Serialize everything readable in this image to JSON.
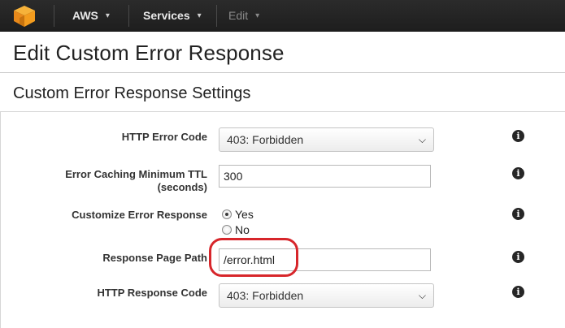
{
  "nav": {
    "brand": "AWS",
    "services": "Services",
    "edit": "Edit",
    "chevron": "▾",
    "logo_color": "#f39c1e"
  },
  "page": {
    "title": "Edit Custom Error Response",
    "section_title": "Custom Error Response Settings"
  },
  "form": {
    "http_error_code": {
      "label": "HTTP Error Code",
      "value": "403: Forbidden"
    },
    "caching_ttl": {
      "label": "Error Caching Minimum TTL",
      "label_line2": "(seconds)",
      "value": "300"
    },
    "customize": {
      "label": "Customize Error Response",
      "option_yes": "Yes",
      "option_no": "No",
      "selected": "Yes"
    },
    "response_page_path": {
      "label": "Response Page Path",
      "value": "/error.html"
    },
    "http_response_code": {
      "label": "HTTP Response Code",
      "value": "403: Forbidden"
    },
    "info_glyph": "i",
    "caret": "⌄"
  },
  "colors": {
    "topbar": "#1e1e1e",
    "highlight": "#d7262b"
  }
}
